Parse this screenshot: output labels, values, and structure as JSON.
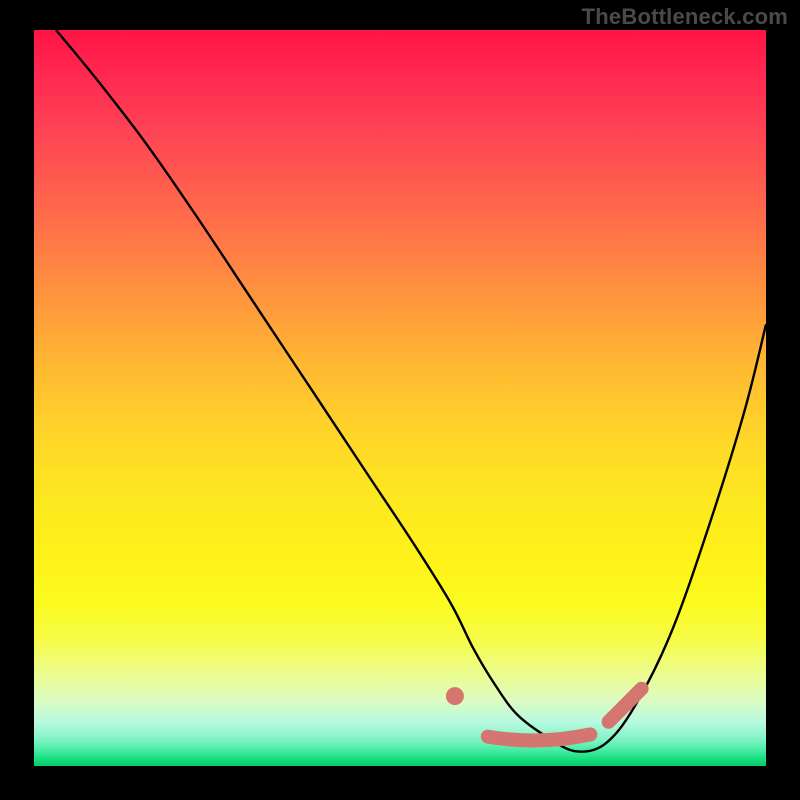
{
  "watermark": "TheBottleneck.com",
  "chart_data": {
    "type": "line",
    "title": "",
    "xlabel": "",
    "ylabel": "",
    "xlim": [
      0,
      100
    ],
    "ylim": [
      0,
      100
    ],
    "grid": false,
    "series": [
      {
        "name": "curve",
        "x": [
          3,
          8,
          15,
          22,
          30,
          38,
          46,
          52,
          57,
          60,
          63,
          66,
          70,
          74,
          78,
          82,
          87,
          92,
          97,
          100
        ],
        "values": [
          100,
          94,
          85,
          75,
          63,
          51,
          39,
          30,
          22,
          16,
          11,
          7,
          4,
          2,
          3,
          8,
          18,
          32,
          48,
          60
        ]
      }
    ],
    "markers": {
      "dot": {
        "x": 57.5,
        "y": 9.5
      },
      "segment": {
        "x0": 62,
        "y0": 4.0,
        "x1": 76,
        "y1": 4.3
      },
      "tail": {
        "x0": 78.5,
        "y0": 6.0,
        "x1": 83,
        "y1": 10.5
      }
    },
    "gradient_stops": [
      {
        "pos": 0.0,
        "color": "#ff1446"
      },
      {
        "pos": 0.5,
        "color": "#ffd024"
      },
      {
        "pos": 0.8,
        "color": "#fff21a"
      },
      {
        "pos": 0.96,
        "color": "#7ef3c4"
      },
      {
        "pos": 1.0,
        "color": "#0acc66"
      }
    ]
  }
}
